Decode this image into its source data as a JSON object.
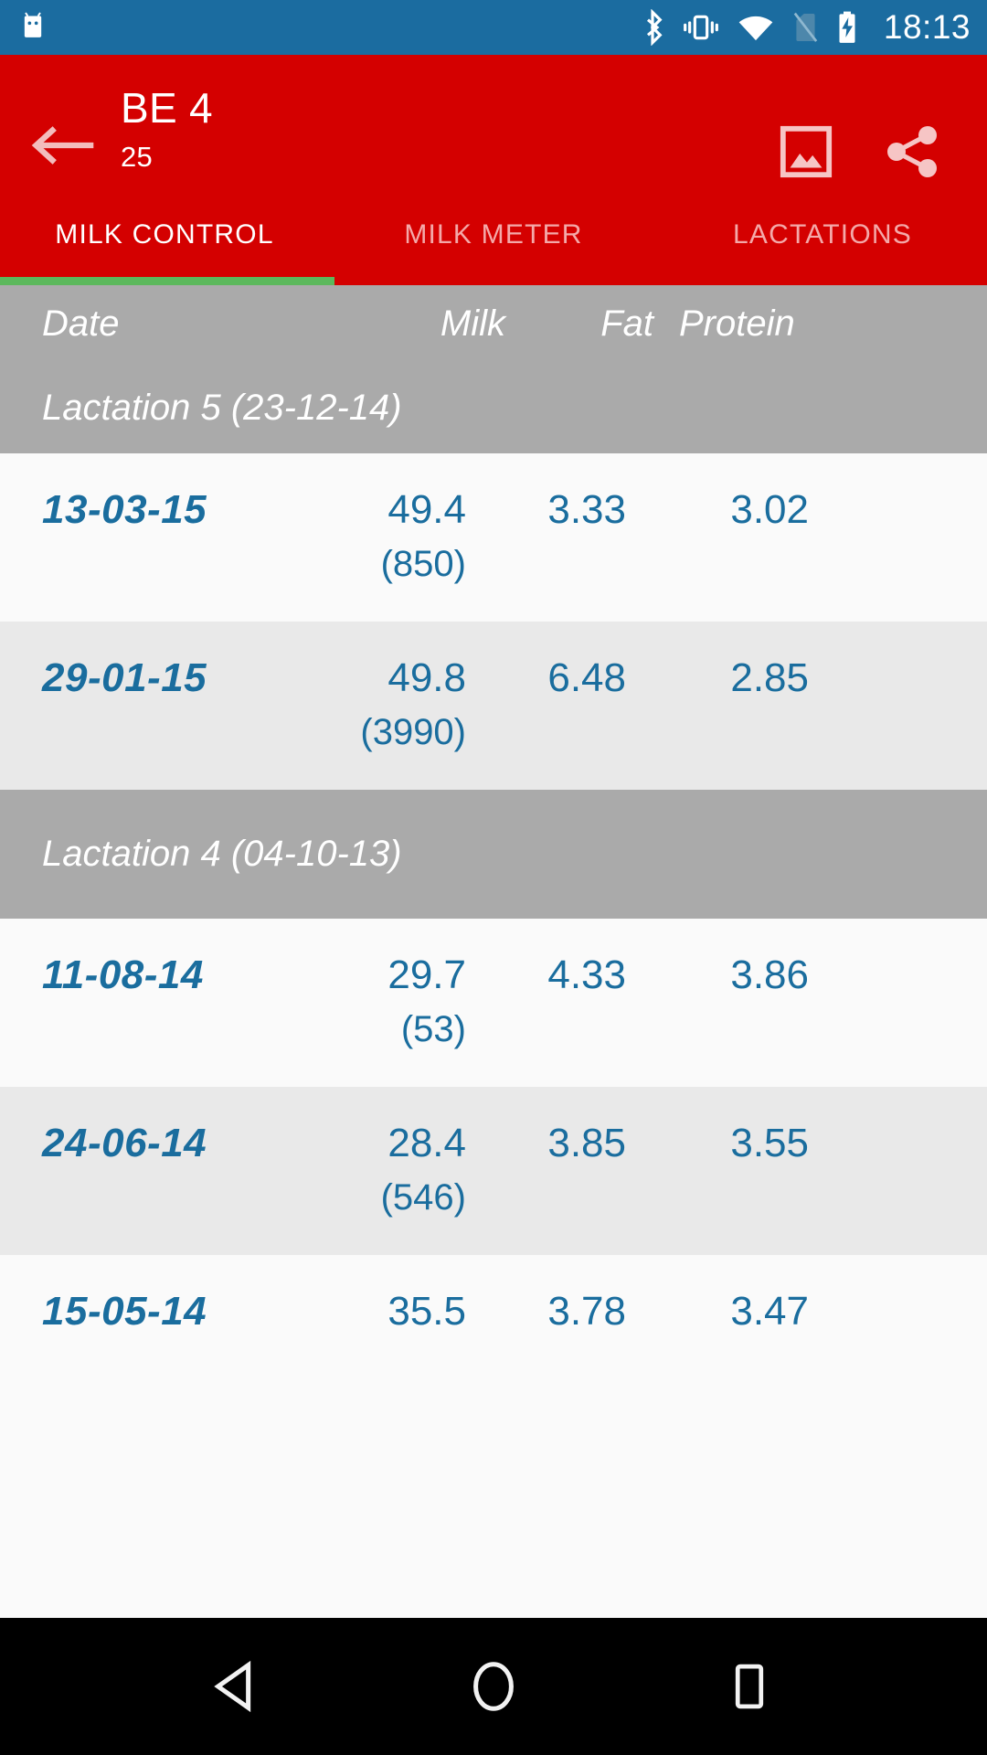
{
  "status_bar": {
    "time": "18:13",
    "icons": [
      "android-mascot-icon",
      "bluetooth-icon",
      "vibrate-icon",
      "wifi-icon",
      "no-sim-icon",
      "battery-charging-icon"
    ],
    "background_color": "#1b6ca0"
  },
  "app_bar": {
    "back_label": "back-arrow",
    "title": "BE 4",
    "subtitle": "25",
    "background_color": "#d40000",
    "actions": [
      {
        "name": "image-chart-icon",
        "label": "Chart"
      },
      {
        "name": "share-icon",
        "label": "Share"
      }
    ]
  },
  "tabs": {
    "items": [
      {
        "label": "MILK CONTROL",
        "active": true
      },
      {
        "label": "MILK METER",
        "active": false
      },
      {
        "label": "LACTATIONS",
        "active": false
      }
    ],
    "indicator_color": "#5cb85c",
    "active_color": "#ffffff",
    "inactive_color": "#f4a9a9"
  },
  "table": {
    "columns": {
      "date": "Date",
      "milk": "Milk",
      "fat": "Fat",
      "protein": "Protein"
    },
    "header_background": "#aaaaaa",
    "value_color": "#1a6d9e",
    "groups": [
      {
        "label": "Lactation 5 (23-12-14)",
        "rows": [
          {
            "date": "13-03-15",
            "milk": "49.4",
            "milk_sub": "(850)",
            "fat": "3.33",
            "protein": "3.02"
          },
          {
            "date": "29-01-15",
            "milk": "49.8",
            "milk_sub": "(3990)",
            "fat": "6.48",
            "protein": "2.85"
          }
        ]
      },
      {
        "label": "Lactation 4 (04-10-13)",
        "rows": [
          {
            "date": "11-08-14",
            "milk": "29.7",
            "milk_sub": "(53)",
            "fat": "4.33",
            "protein": "3.86"
          },
          {
            "date": "24-06-14",
            "milk": "28.4",
            "milk_sub": "(546)",
            "fat": "3.85",
            "protein": "3.55"
          },
          {
            "date": "15-05-14",
            "milk": "35.5",
            "milk_sub": "",
            "fat": "3.78",
            "protein": "3.47"
          }
        ]
      }
    ]
  },
  "nav_bar": {
    "background_color": "#000000",
    "buttons": [
      {
        "name": "nav-back-icon",
        "label": "Back"
      },
      {
        "name": "nav-home-icon",
        "label": "Home"
      },
      {
        "name": "nav-recents-icon",
        "label": "Recents"
      }
    ]
  }
}
